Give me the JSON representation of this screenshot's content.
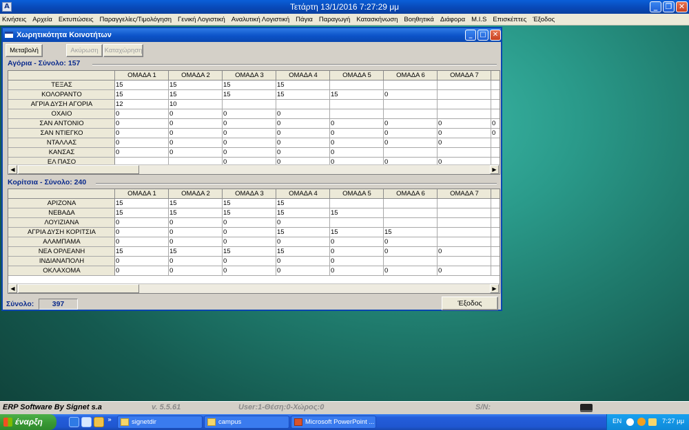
{
  "app": {
    "title": "Τετάρτη  13/1/2016 7:27:29 μμ",
    "icon_letter": "A"
  },
  "menu": [
    "Κινήσεις",
    "Αρχεία",
    "Εκτυπώσεις",
    "Παραγγελίες/Τιμολόγηση",
    "Γενική Λογιστική",
    "Αναλυτική Λογιστική",
    "Πάγια",
    "Παραγωγή",
    "Κατασκήνωση",
    "Βοηθητικά",
    "Διάφορα",
    "M.I.S",
    "Επισκέπτες",
    "Έξοδος"
  ],
  "window": {
    "title": "Χωρητικότητα Κοινοτήτων",
    "buttons": {
      "change": "Μεταβολή",
      "cancel": "Ακύρωση",
      "save": "Καταχώρηση"
    }
  },
  "headers": [
    "ΟΜΑΔΑ   1",
    "ΟΜΑΔΑ 2",
    "ΟΜΑΔΑ 3",
    "ΟΜΑΔΑ 4",
    "ΟΜΑΔΑ 5",
    "ΟΜΑΔΑ 6",
    "ΟΜΑΔΑ 7"
  ],
  "boys": {
    "title": "Αγόρια - Σύνολο: 157",
    "rows": [
      {
        "name": "ΤΕΞΑΣ",
        "values": [
          "15",
          "15",
          "15",
          "15",
          "",
          "",
          "",
          ""
        ]
      },
      {
        "name": "ΚΟΛΟΡΑΝΤΟ",
        "values": [
          "15",
          "15",
          "15",
          "15",
          "15",
          "0",
          "",
          ""
        ]
      },
      {
        "name": "ΑΓΡΙΑ ΔΥΣΗ ΑΓΟΡΙΑ",
        "values": [
          "12",
          "10",
          "",
          "",
          "",
          "",
          "",
          ""
        ]
      },
      {
        "name": "ΟΧΑΙΟ",
        "values": [
          "0",
          "0",
          "0",
          "0",
          "",
          "",
          "",
          ""
        ]
      },
      {
        "name": "ΣΑΝ ΑΝΤΟΝΙΟ",
        "values": [
          "0",
          "0",
          "0",
          "0",
          "0",
          "0",
          "0",
          "0"
        ]
      },
      {
        "name": "ΣΑΝ ΝΤΙΕΓΚΟ",
        "values": [
          "0",
          "0",
          "0",
          "0",
          "0",
          "0",
          "0",
          "0"
        ]
      },
      {
        "name": "ΝΤΑΛΛΑΣ",
        "values": [
          "0",
          "0",
          "0",
          "0",
          "0",
          "0",
          "0",
          ""
        ]
      },
      {
        "name": "ΚΑΝΣΑΣ",
        "values": [
          "0",
          "0",
          "0",
          "0",
          "0",
          "",
          "",
          ""
        ]
      },
      {
        "name": "ΕΛ ΠΑΣΟ",
        "values": [
          "",
          "",
          "0",
          "0",
          "0",
          "0",
          "0",
          ""
        ]
      }
    ]
  },
  "girls": {
    "title": "Κορίτσια - Σύνολο: 240",
    "rows": [
      {
        "name": "ΑΡΙΖΟΝΑ",
        "values": [
          "15",
          "15",
          "15",
          "15",
          "",
          "",
          "",
          ""
        ]
      },
      {
        "name": "ΝΕΒΑΔΑ",
        "values": [
          "15",
          "15",
          "15",
          "15",
          "15",
          "",
          "",
          ""
        ]
      },
      {
        "name": "ΛΟΥΙΖΙΑΝΑ",
        "values": [
          "0",
          "0",
          "0",
          "0",
          "",
          "",
          "",
          ""
        ]
      },
      {
        "name": "ΑΓΡΙΑ ΔΥΣΗ  ΚΟΡΙΤΣΙΑ",
        "values": [
          "0",
          "0",
          "0",
          "15",
          "15",
          "15",
          "",
          ""
        ]
      },
      {
        "name": "ΑΛΑΜΠΑΜΑ",
        "values": [
          "0",
          "0",
          "0",
          "0",
          "0",
          "0",
          "",
          ""
        ]
      },
      {
        "name": "ΝΕΑ ΟΡΛΕΑΝΗ",
        "values": [
          "15",
          "15",
          "15",
          "15",
          "0",
          "0",
          "0",
          ""
        ]
      },
      {
        "name": "ΙΝΔΙΑΝΑΠΟΛΗ",
        "values": [
          "0",
          "0",
          "0",
          "0",
          "0",
          "",
          "",
          ""
        ]
      },
      {
        "name": "ΟΚΛΑΧΟΜΑ",
        "values": [
          "0",
          "0",
          "0",
          "0",
          "0",
          "0",
          "0",
          ""
        ]
      }
    ]
  },
  "total": {
    "label": "Σύνολο:",
    "value": "397"
  },
  "exit_button": "Έξοδος",
  "status": {
    "company": "ERP Software By Signet s.a",
    "version": "v. 5.5.61",
    "user": "User:1-Θέση:0-Χώρος:0",
    "sn": "S/N:"
  },
  "taskbar": {
    "start": "έναρξη",
    "tasks": [
      "signetdir",
      "campus",
      "Microsoft PowerPoint ..."
    ],
    "lang": "EN",
    "time": "7:27 μμ"
  }
}
